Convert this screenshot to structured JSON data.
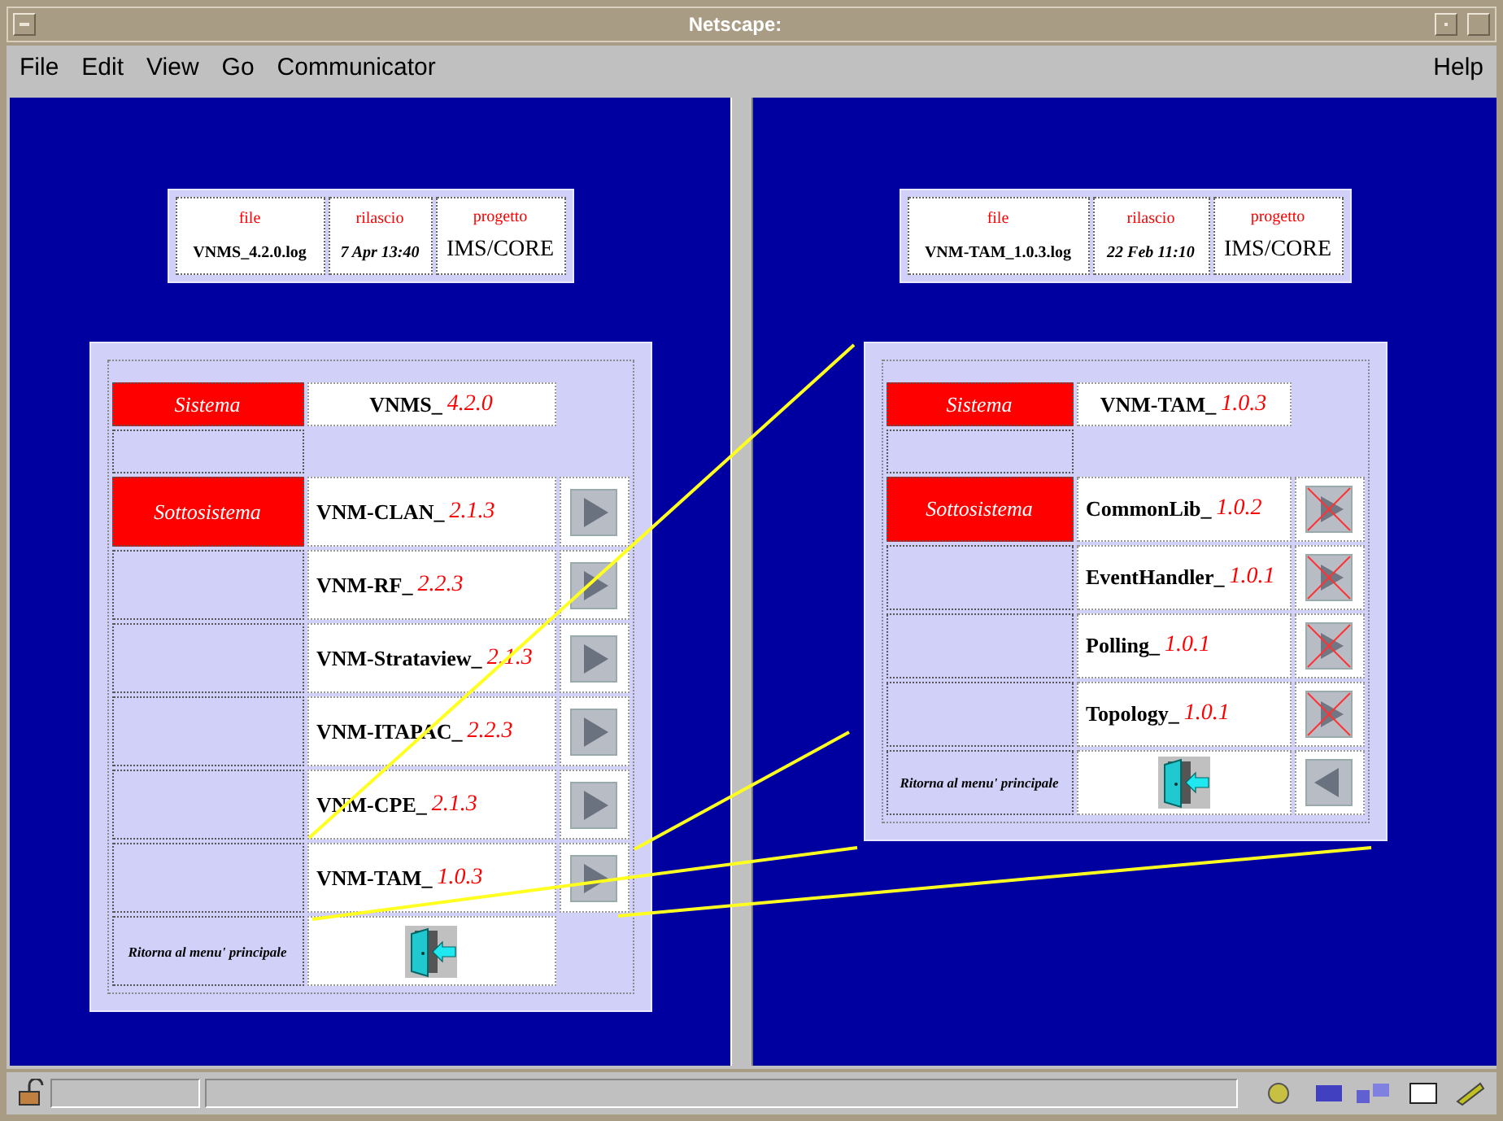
{
  "window": {
    "title": "Netscape:"
  },
  "menu_bar": {
    "items": [
      "File",
      "Edit",
      "View",
      "Go",
      "Communicator"
    ],
    "help": "Help"
  },
  "frames": [
    {
      "info": {
        "columns": [
          "file",
          "rilascio",
          "progetto"
        ],
        "file": "VNMS_4.2.0.log",
        "release": "7 Apr 13:40",
        "project": "IMS/CORE"
      },
      "menu": {
        "system_label": "Sistema",
        "system_name": "VNMS_",
        "system_version": "4.2.0",
        "subsystem_label": "Sottosistema",
        "rows": [
          {
            "name": "VNM-CLAN_",
            "version": "2.1.3",
            "kind": "play"
          },
          {
            "name": "VNM-RF_",
            "version": "2.2.3",
            "kind": "play"
          },
          {
            "name": "VNM-Strataview_",
            "version": "2.1.3",
            "kind": "play"
          },
          {
            "name": "VNM-ITAPAC_",
            "version": "2.2.3",
            "kind": "play"
          },
          {
            "name": "VNM-CPE_",
            "version": "2.1.3",
            "kind": "play"
          },
          {
            "name": "VNM-TAM_",
            "version": "1.0.3",
            "kind": "play"
          }
        ],
        "return": {
          "label": "Ritorna al menu' principale"
        }
      }
    },
    {
      "info": {
        "columns": [
          "file",
          "rilascio",
          "progetto"
        ],
        "file": "VNM-TAM_1.0.3.log",
        "release": "22 Feb 11:10",
        "project": "IMS/CORE"
      },
      "menu": {
        "system_label": "Sistema",
        "system_name": "VNM-TAM_",
        "system_version": "1.0.3",
        "subsystem_label": "Sottosistema",
        "rows": [
          {
            "name": "CommonLib_",
            "version": "1.0.2",
            "kind": "broken"
          },
          {
            "name": "EventHandler_",
            "version": "1.0.1",
            "kind": "broken"
          },
          {
            "name": "Polling_",
            "version": "1.0.1",
            "kind": "broken"
          },
          {
            "name": "Topology_",
            "version": "1.0.1",
            "kind": "broken"
          }
        ],
        "return": {
          "label": "Ritorna al menu' principale",
          "kind": "back"
        }
      }
    }
  ]
}
